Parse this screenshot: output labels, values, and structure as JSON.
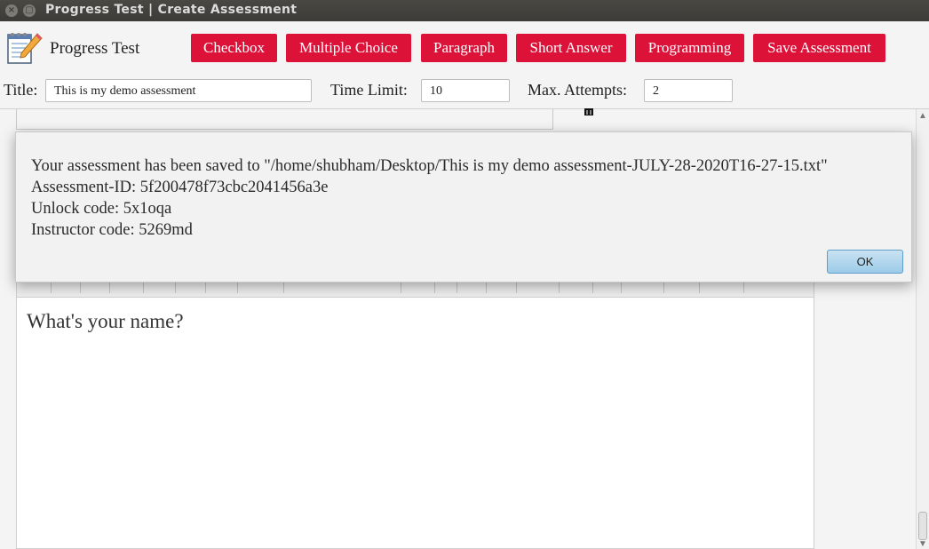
{
  "window": {
    "title": "Progress Test | Create Assessment",
    "close_glyph": "×",
    "min_glyph": "▢"
  },
  "app": {
    "name": "Progress Test",
    "logo_icon": "notepad-pencil-icon"
  },
  "toolbar": {
    "buttons": [
      "Checkbox",
      "Multiple Choice",
      "Paragraph",
      "Short Answer",
      "Programming",
      "Save Assessment"
    ],
    "button_color": "#dc1239"
  },
  "form": {
    "title_label": "Title:",
    "title_value": "This is my demo assessment",
    "time_limit_label": "Time Limit:",
    "time_limit_value": "10",
    "max_attempts_label": "Max. Attempts:",
    "max_attempts_value": "2"
  },
  "editor": {
    "question_text": "What's your name?"
  },
  "dialog": {
    "message_lines": [
      "Your assessment has been saved to \"/home/shubham/Desktop/This is my demo assessment-JULY-28-2020T16-27-15.txt\"",
      "Assessment-ID: 5f200478f73cbc2041456a3e",
      "Unlock code: 5x1oqa",
      "Instructor code: 5269md"
    ],
    "ok_label": "OK"
  }
}
